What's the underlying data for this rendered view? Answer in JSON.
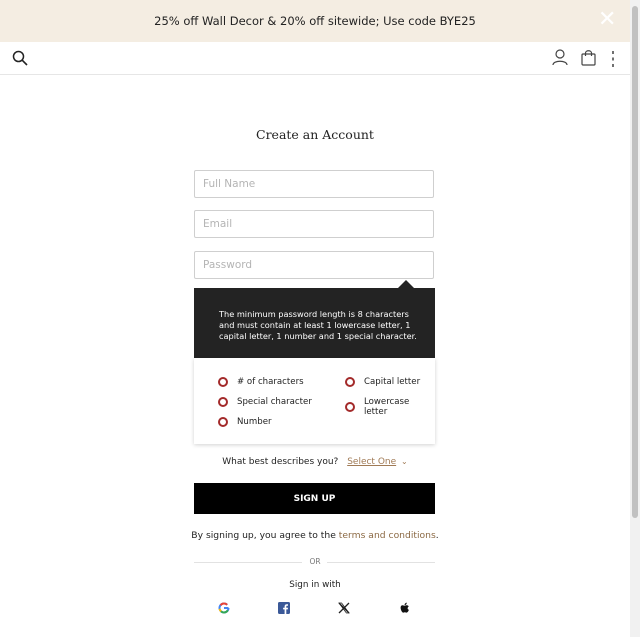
{
  "banner": {
    "text": "25% off Wall Decor & 20% off sitewide; Use code BYE25",
    "close_glyph": "✕"
  },
  "nav": {
    "search_icon": "search-icon",
    "user_icon": "user-icon",
    "bag_icon": "shopping-bag-icon",
    "menu_icon": "kebab-menu-icon"
  },
  "form": {
    "title": "Create an Account",
    "full_name_placeholder": "Full Name",
    "email_placeholder": "Email",
    "password_placeholder": "Password",
    "password_tooltip": "The minimum password length is 8 characters and must contain at least 1 lowercase letter, 1 capital letter, 1 number and 1 special character.",
    "requirements": [
      "# of characters",
      "Capital letter",
      "Special character",
      "Lowercase letter",
      "Number"
    ],
    "describe_label": "What best describes you?",
    "describe_select": "Select One",
    "signup_label": "SIGN UP",
    "terms_prefix": "By signing up, you agree to the ",
    "terms_link": "terms and conditions",
    "terms_suffix": ".",
    "or_label": "OR",
    "signin_with": "Sign in with"
  },
  "colors": {
    "banner_bg": "#f4ede2",
    "accent_link": "#a07a55",
    "requirement_ring": "#a32a2a",
    "tooltip_bg": "#232323"
  },
  "social": [
    "google-icon",
    "facebook-icon",
    "x-icon",
    "apple-icon"
  ]
}
